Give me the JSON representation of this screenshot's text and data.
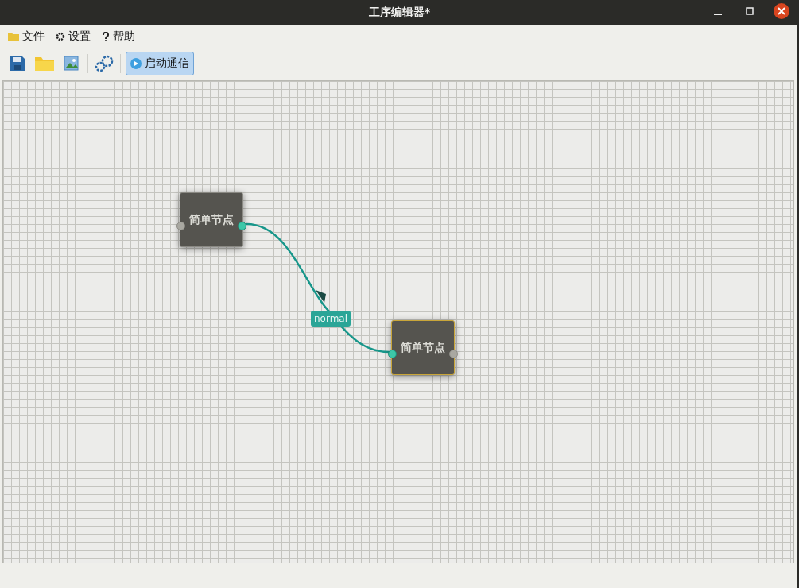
{
  "window": {
    "title": "工序编辑器*"
  },
  "menu": [
    {
      "kind": "folder",
      "label": "文件"
    },
    {
      "kind": "gear",
      "label": "设置"
    },
    {
      "kind": "question",
      "label": "帮助"
    }
  ],
  "toolbar": {
    "buttons": [
      {
        "kind": "save"
      },
      {
        "kind": "open"
      },
      {
        "kind": "image"
      },
      {
        "kind": "separator"
      },
      {
        "kind": "settings"
      },
      {
        "kind": "separator"
      },
      {
        "kind": "toggle",
        "label": "启动通信",
        "selected": true
      }
    ]
  },
  "canvas": {
    "nodes": [
      {
        "title": "简单节点",
        "selected": false,
        "input_connected": false,
        "output_connected": true
      },
      {
        "title": "简单节点",
        "selected": true,
        "input_connected": true,
        "output_connected": false
      }
    ],
    "edges": [
      {
        "label": "normal"
      }
    ]
  }
}
